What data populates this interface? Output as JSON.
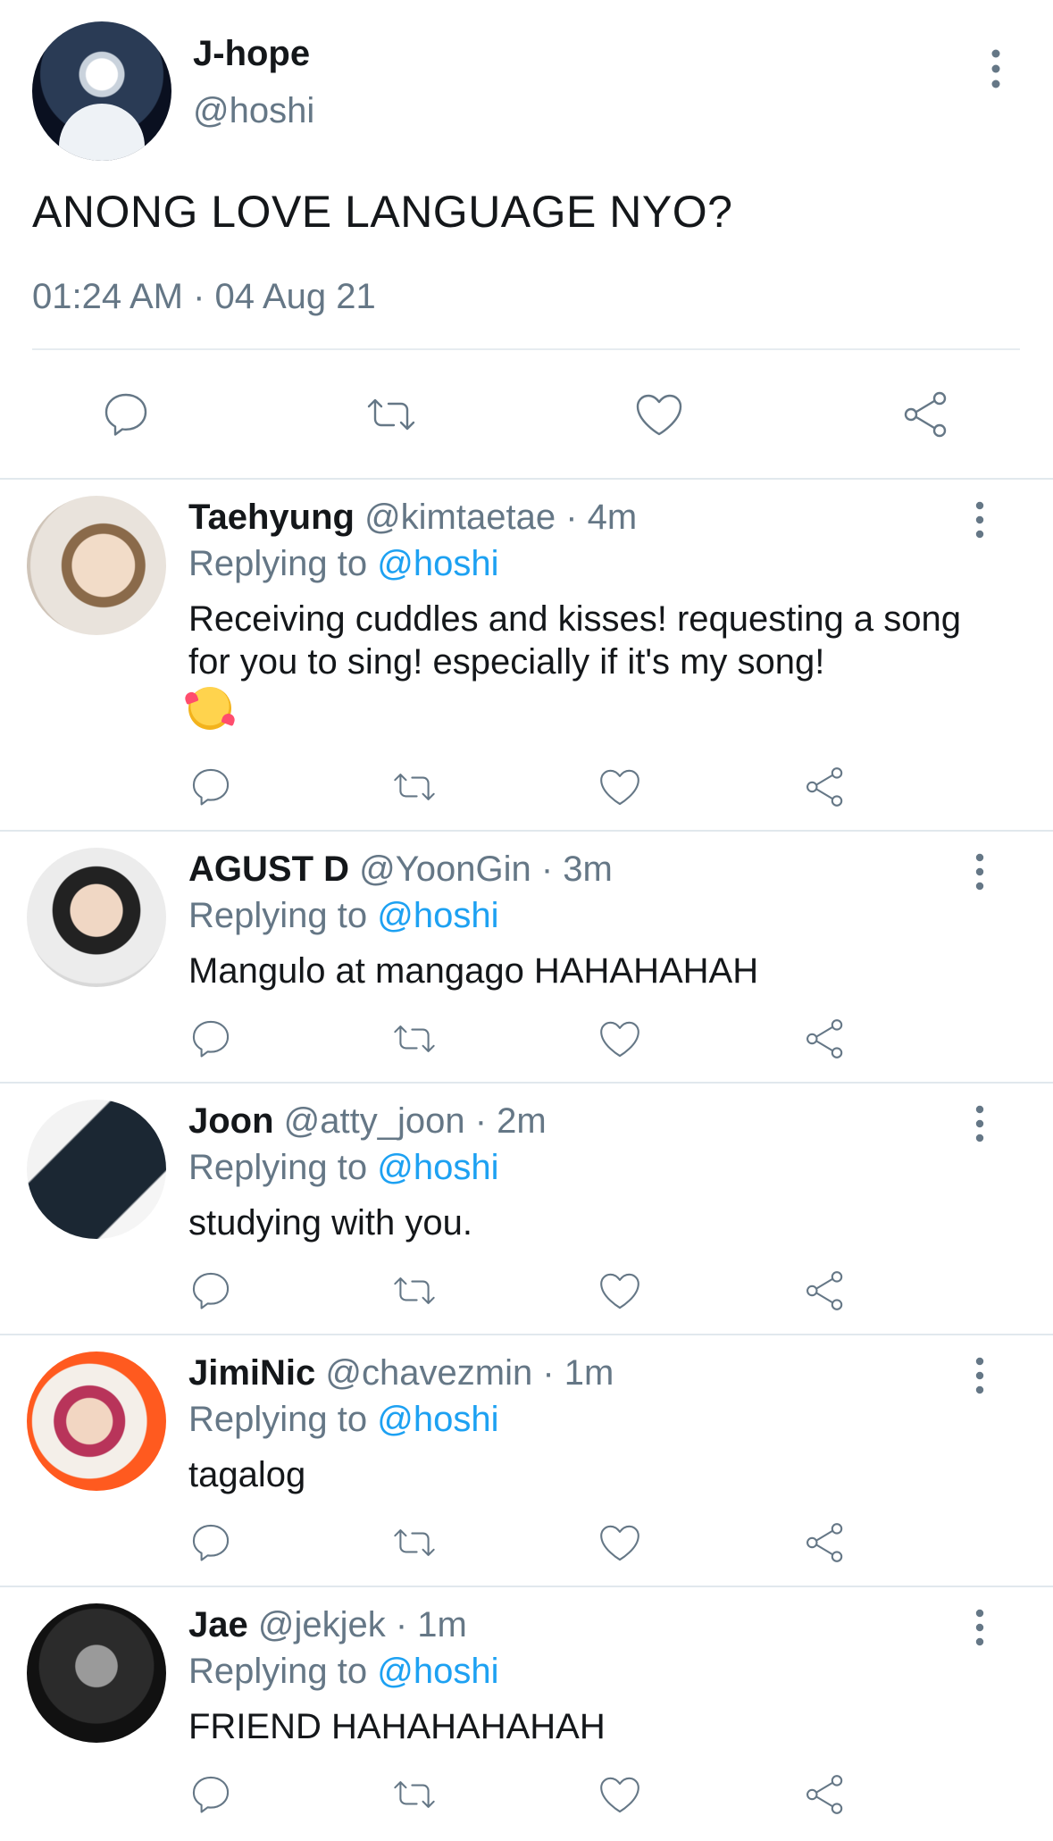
{
  "tweet": {
    "name": "J-hope",
    "handle": "@hoshi",
    "text": "ANONG LOVE LANGUAGE NYO?",
    "timestamp": "01:24 AM · 04 Aug 21"
  },
  "replies": [
    {
      "name": "Taehyung",
      "handle": "@kimtaetae",
      "time": "· 4m",
      "replying_prefix": "Replying to ",
      "mention": "@hoshi",
      "text": "Receiving cuddles and kisses! requesting a song for you to sing! especially if it's my song!",
      "emoji": "smiling-face-with-hearts"
    },
    {
      "name": "AGUST D",
      "handle": "@YoonGin",
      "time": "· 3m",
      "replying_prefix": "Replying to ",
      "mention": "@hoshi",
      "text": "Mangulo at mangago HAHAHAHAH"
    },
    {
      "name": "Joon",
      "handle": "@atty_joon",
      "time": "· 2m",
      "replying_prefix": "Replying to ",
      "mention": "@hoshi",
      "text": "studying with you."
    },
    {
      "name": "JimiNic",
      "handle": "@chavezmin",
      "time": "· 1m",
      "replying_prefix": "Replying to ",
      "mention": "@hoshi",
      "text": "tagalog"
    },
    {
      "name": "Jae",
      "handle": "@jekjek",
      "time": "· 1m",
      "replying_prefix": "Replying to ",
      "mention": "@hoshi",
      "text": "FRIEND HAHAHAHAHAH"
    }
  ],
  "icons": {
    "reply": "comment-icon",
    "retweet": "retweet-icon",
    "like": "heart-icon",
    "share": "share-icon",
    "more": "more-vertical-icon"
  },
  "colors": {
    "text": "#14171a",
    "secondary": "#657786",
    "link": "#1da1f2",
    "divider": "#e1e8ed"
  }
}
